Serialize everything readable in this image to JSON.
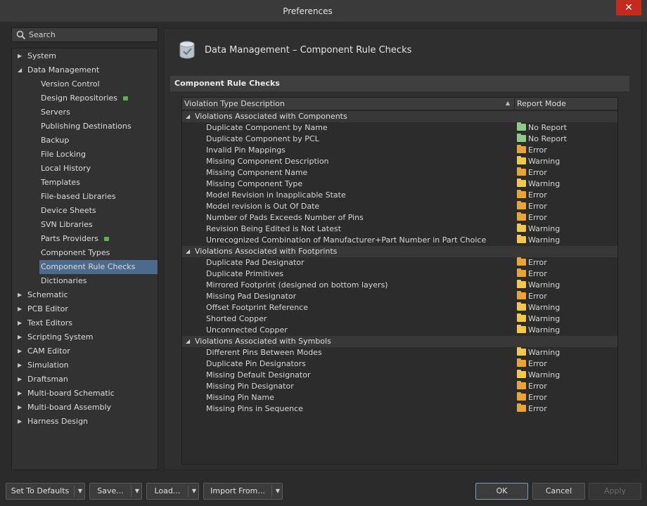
{
  "window": {
    "title": "Preferences"
  },
  "search": {
    "placeholder": "Search"
  },
  "tree": [
    {
      "label": "System",
      "level": 0,
      "arrow": "▶"
    },
    {
      "label": "Data Management",
      "level": 0,
      "arrow": "◢"
    },
    {
      "label": "Version Control",
      "level": 1
    },
    {
      "label": "Design Repositories",
      "level": 1,
      "badge": "green-icon"
    },
    {
      "label": "Servers",
      "level": 1
    },
    {
      "label": "Publishing Destinations",
      "level": 1
    },
    {
      "label": "Backup",
      "level": 1
    },
    {
      "label": "File Locking",
      "level": 1
    },
    {
      "label": "Local History",
      "level": 1
    },
    {
      "label": "Templates",
      "level": 1
    },
    {
      "label": "File-based Libraries",
      "level": 1
    },
    {
      "label": "Device Sheets",
      "level": 1
    },
    {
      "label": "SVN Libraries",
      "level": 1
    },
    {
      "label": "Parts Providers",
      "level": 1,
      "badge": "green-icon"
    },
    {
      "label": "Component Types",
      "level": 1
    },
    {
      "label": "Component Rule Checks",
      "level": 1,
      "selected": true
    },
    {
      "label": "Dictionaries",
      "level": 1
    },
    {
      "label": "Schematic",
      "level": 0,
      "arrow": "▶"
    },
    {
      "label": "PCB Editor",
      "level": 0,
      "arrow": "▶"
    },
    {
      "label": "Text Editors",
      "level": 0,
      "arrow": "▶"
    },
    {
      "label": "Scripting System",
      "level": 0,
      "arrow": "▶"
    },
    {
      "label": "CAM Editor",
      "level": 0,
      "arrow": "▶"
    },
    {
      "label": "Simulation",
      "level": 0,
      "arrow": "▶"
    },
    {
      "label": "Draftsman",
      "level": 0,
      "arrow": "▶"
    },
    {
      "label": "Multi-board Schematic",
      "level": 0,
      "arrow": "▶"
    },
    {
      "label": "Multi-board Assembly",
      "level": 0,
      "arrow": "▶"
    },
    {
      "label": "Harness Design",
      "level": 0,
      "arrow": "▶"
    }
  ],
  "page": {
    "title": "Data Management – Component Rule Checks",
    "section": "Component Rule Checks",
    "columns": {
      "description": "Violation Type Description",
      "mode": "Report Mode"
    }
  },
  "modeColors": {
    "No Report": "#8fc98a",
    "Error": "#e8a435",
    "Warning": "#f1c84a"
  },
  "groups": [
    {
      "label": "Violations Associated with Components",
      "rows": [
        {
          "desc": "Duplicate Component by Name",
          "mode": "No Report"
        },
        {
          "desc": "Duplicate Component by PCL",
          "mode": "No Report"
        },
        {
          "desc": "Invalid Pin Mappings",
          "mode": "Error"
        },
        {
          "desc": "Missing Component Description",
          "mode": "Warning"
        },
        {
          "desc": "Missing Component Name",
          "mode": "Error"
        },
        {
          "desc": "Missing Component Type",
          "mode": "Warning"
        },
        {
          "desc": "Model Revision in Inapplicable State",
          "mode": "Error"
        },
        {
          "desc": "Model revision is Out Of Date",
          "mode": "Error"
        },
        {
          "desc": "Number of Pads Exceeds Number of Pins",
          "mode": "Error"
        },
        {
          "desc": "Revision Being Edited is Not Latest",
          "mode": "Warning"
        },
        {
          "desc": "Unrecognized Combination of Manufacturer+Part Number in Part Choice",
          "mode": "Warning"
        }
      ]
    },
    {
      "label": "Violations Associated with Footprints",
      "rows": [
        {
          "desc": "Duplicate Pad Designator",
          "mode": "Error"
        },
        {
          "desc": "Duplicate Primitives",
          "mode": "Error"
        },
        {
          "desc": "Mirrored Footprint (designed on bottom layers)",
          "mode": "Warning"
        },
        {
          "desc": "Missing Pad Designator",
          "mode": "Error"
        },
        {
          "desc": "Offset Footprint Reference",
          "mode": "Warning"
        },
        {
          "desc": "Shorted Copper",
          "mode": "Warning"
        },
        {
          "desc": "Unconnected Copper",
          "mode": "Warning"
        }
      ]
    },
    {
      "label": "Violations Associated with Symbols",
      "rows": [
        {
          "desc": "Different Pins Between Modes",
          "mode": "Warning"
        },
        {
          "desc": "Duplicate Pin Designators",
          "mode": "Error"
        },
        {
          "desc": "Missing Default Designator",
          "mode": "Warning"
        },
        {
          "desc": "Missing Pin Designator",
          "mode": "Error"
        },
        {
          "desc": "Missing Pin Name",
          "mode": "Error"
        },
        {
          "desc": "Missing Pins in Sequence",
          "mode": "Error"
        }
      ]
    }
  ],
  "buttons": {
    "set_defaults": "Set To Defaults",
    "save": "Save...",
    "load": "Load...",
    "import_from": "Import From...",
    "ok": "OK",
    "cancel": "Cancel",
    "apply": "Apply"
  }
}
